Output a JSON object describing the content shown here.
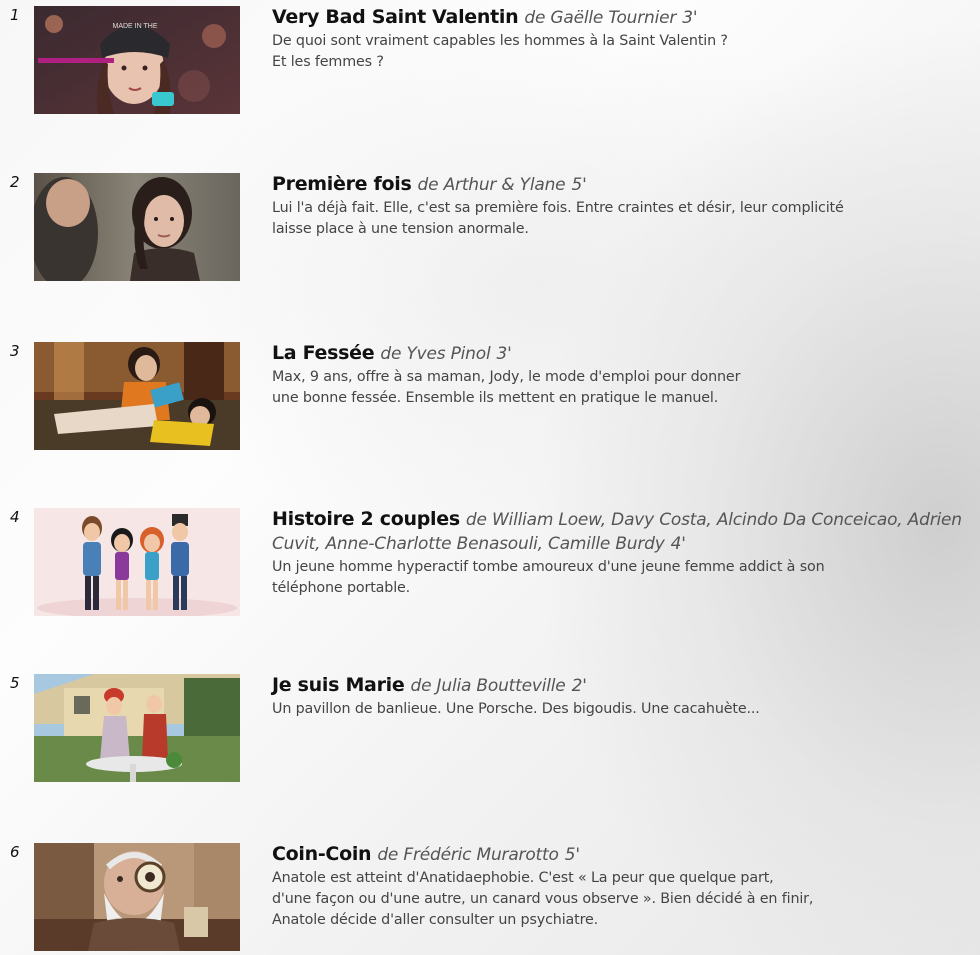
{
  "films": [
    {
      "number": "1",
      "title": "Very Bad Saint Valentin",
      "credit": "de Gaëlle Tournier",
      "duration": "3'",
      "description_lines": [
        "De quoi sont vraiment capables les hommes à la Saint Valentin ?",
        "Et les femmes ?"
      ],
      "thumbnail_caption": "MADE IN THE",
      "thumbnail_icon": "film-still-woman-beanie"
    },
    {
      "number": "2",
      "title": "Première fois",
      "credit": "de Arthur & Ylane",
      "duration": "5'",
      "description_lines": [
        "Lui l'a déjà fait. Elle, c'est sa première fois. Entre craintes et désir, leur complicité",
        "laisse place à une tension anormale."
      ],
      "thumbnail_icon": "film-still-couple"
    },
    {
      "number": "3",
      "title": "La Fessée",
      "credit": "de Yves Pinol",
      "duration": "3'",
      "description_lines": [
        "Max, 9 ans, offre à sa maman, Jody, le mode d'emploi pour donner",
        "une bonne fessée. Ensemble ils mettent en pratique le manuel."
      ],
      "thumbnail_icon": "film-still-sofa"
    },
    {
      "number": "4",
      "title": "Histoire 2 couples",
      "credit": "de William Loew, Davy Costa, Alcindo Da Conceicao, Adrien Cuvit, Anne-Charlotte Benasouli, Camille Burdy",
      "duration": "4'",
      "description_lines": [
        "Un jeune homme hyperactif tombe amoureux d'une jeune femme addict à son",
        "téléphone portable."
      ],
      "thumbnail_icon": "animated-four-characters"
    },
    {
      "number": "5",
      "title": "Je suis Marie",
      "credit": "de Julia Boutteville",
      "duration": "2'",
      "description_lines": [
        "Un pavillon de banlieue. Une Porsche. Des bigoudis. Une cacahuète..."
      ],
      "thumbnail_icon": "film-still-garden"
    },
    {
      "number": "6",
      "title": "Coin-Coin",
      "credit": "de Frédéric Murarotto",
      "duration": "5'",
      "description_lines": [
        "Anatole est atteint d'Anatidaephobie. C'est « La peur que quelque part,",
        "d'une façon ou d'une autre, un canard vous observe ». Bien décidé à en finir,",
        "Anatole décide d'aller consulter un psychiatre."
      ],
      "thumbnail_icon": "film-still-old-man-magnifier"
    }
  ]
}
